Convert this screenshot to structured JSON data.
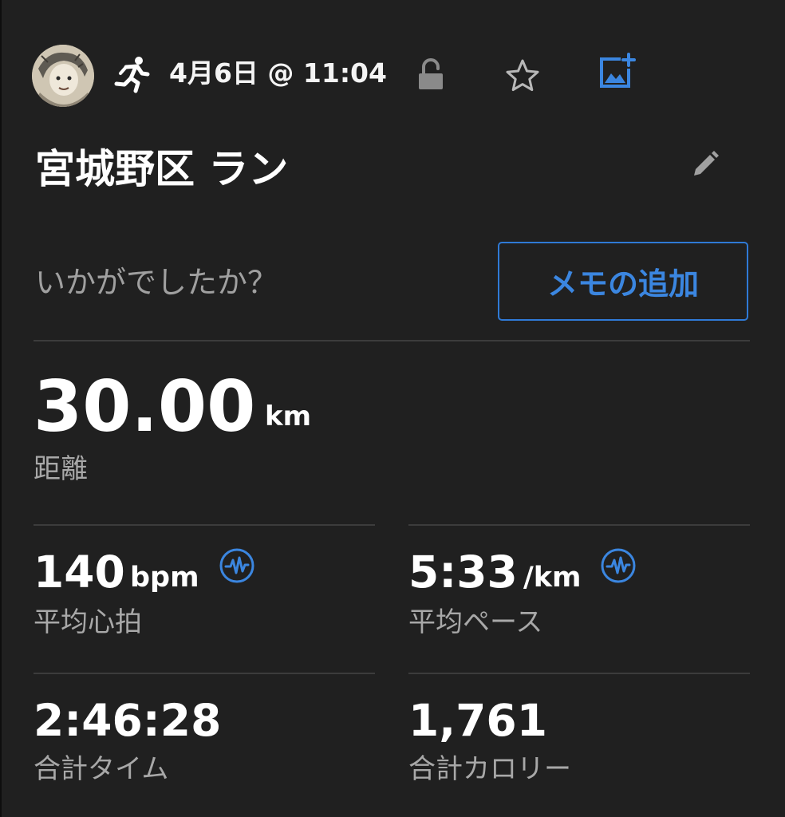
{
  "header": {
    "activity_type_icon": "running-person-icon",
    "date_time": "4月6日 @ 11:04",
    "privacy_icon": "unlocked-padlock-icon",
    "favorite_icon": "star-outline-icon",
    "add_photo_icon": "add-photo-icon"
  },
  "activity": {
    "title": "宮城野区 ラン",
    "edit_icon": "pencil-icon"
  },
  "feedback": {
    "prompt": "いかがでしたか？",
    "memo_button_label": "メモの追加"
  },
  "distance": {
    "value": "30.00",
    "unit": "km",
    "label": "距離"
  },
  "stats": {
    "heart_rate": {
      "value": "140",
      "unit": "bpm",
      "label": "平均心拍",
      "icon": "pulse-wave-icon"
    },
    "pace": {
      "value": "5:33",
      "unit": "/km",
      "label": "平均ペース",
      "icon": "pulse-wave-icon"
    },
    "total_time": {
      "value": "2:46:28",
      "label": "合計タイム"
    },
    "calories": {
      "value": "1,761",
      "label": "合計カロリー"
    }
  },
  "colors": {
    "background": "#202020",
    "accent_blue": "#3b86e0",
    "divider": "#3c3c3c",
    "secondary_text": "#a8a8a8"
  }
}
